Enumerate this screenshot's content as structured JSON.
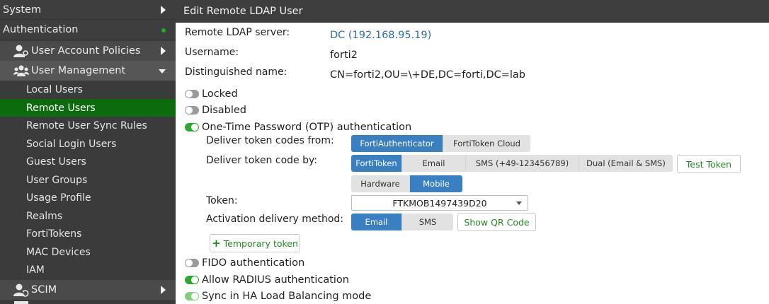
{
  "sidebar": {
    "system": "System",
    "authentication": "Authentication",
    "user_account_policies": "User Account Policies",
    "user_management": "User Management",
    "items": [
      {
        "label": "Local Users"
      },
      {
        "label": "Remote Users",
        "active": true
      },
      {
        "label": "Remote User Sync Rules"
      },
      {
        "label": "Social Login Users"
      },
      {
        "label": "Guest Users"
      },
      {
        "label": "User Groups"
      },
      {
        "label": "Usage Profile"
      },
      {
        "label": "Realms"
      },
      {
        "label": "FortiTokens"
      },
      {
        "label": "MAC Devices"
      },
      {
        "label": "IAM"
      }
    ],
    "scim": "SCIM"
  },
  "main": {
    "title": "Edit Remote LDAP User",
    "fields": {
      "server_label": "Remote LDAP server:",
      "server_value": "DC (192.168.95.19)",
      "username_label": "Username:",
      "username_value": "forti2",
      "dn_label": "Distinguished name:",
      "dn_value": "CN=forti2,OU=\\+DE,DC=forti,DC=lab"
    },
    "toggles": {
      "locked": "Locked",
      "disabled": "Disabled",
      "otp": "One-Time Password (OTP) authentication",
      "fido": "FIDO authentication",
      "radius": "Allow RADIUS authentication",
      "ha": "Sync in HA Load Balancing mode"
    },
    "otp": {
      "deliver_from_label": "Deliver token codes from:",
      "deliver_from_options": [
        "FortiAuthenticator",
        "FortiToken Cloud"
      ],
      "deliver_by_label": "Deliver token code by:",
      "deliver_by_options": [
        "FortiToken",
        "Email",
        "SMS  (+49-123456789)",
        "Dual (Email & SMS)"
      ],
      "test_token": "Test Token",
      "token_type_options": [
        "Hardware",
        "Mobile"
      ],
      "token_label": "Token:",
      "token_value": "FTKMOB1497439D20",
      "activation_label": "Activation delivery method:",
      "activation_options": [
        "Email",
        "SMS"
      ],
      "show_qr": "Show QR Code",
      "temporary_token": "Temporary token"
    }
  },
  "colors": {
    "accent_blue": "#3a7fc1",
    "active_green": "#0c6b0c",
    "toggle_green": "#2ea82e",
    "link_blue": "#2e6fa4"
  }
}
